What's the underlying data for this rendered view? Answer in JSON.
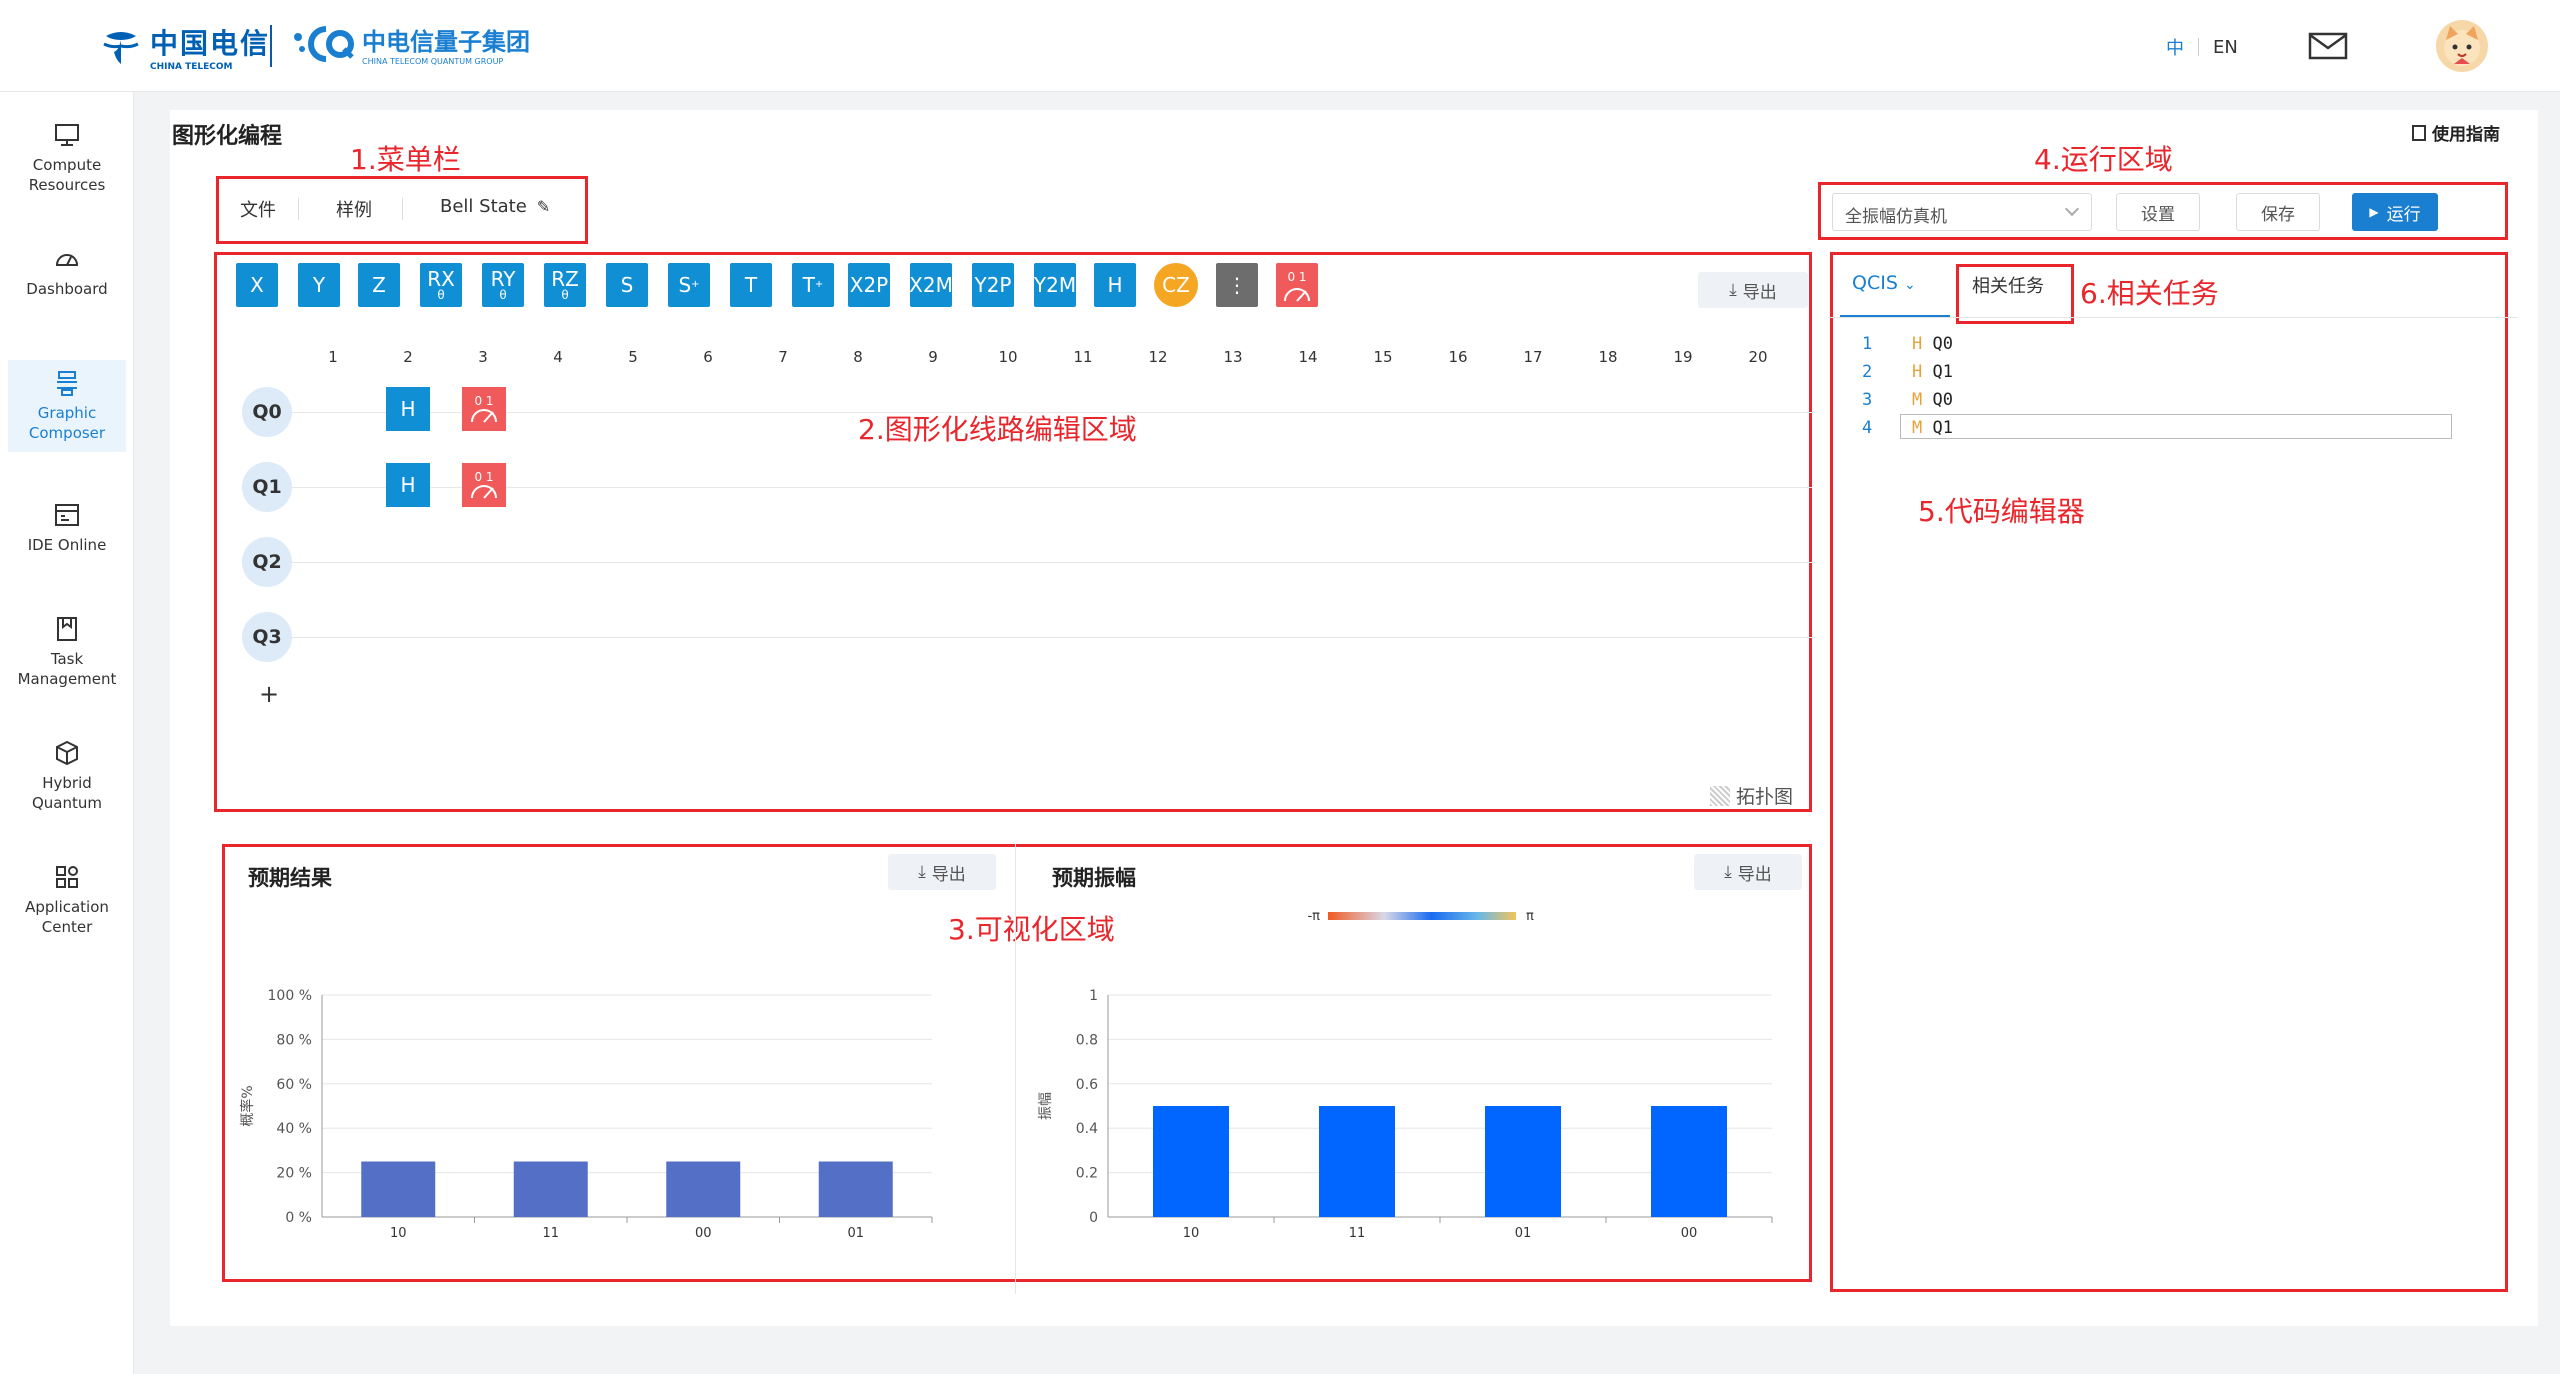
{
  "header": {
    "logo_ct_cn": "中国电信",
    "logo_ct_en": "CHINA TELECOM",
    "logo_q_cn": "中电信量子集团",
    "logo_q_en": "CHINA TELECOM QUANTUM GROUP",
    "lang_zh": "中",
    "lang_en": "EN"
  },
  "sidebar": {
    "items": [
      {
        "label": "Compute Resources",
        "icon": "monitor-icon"
      },
      {
        "label": "Dashboard",
        "icon": "dashboard-icon"
      },
      {
        "label": "Graphic Composer",
        "icon": "composer-icon",
        "active": true
      },
      {
        "label": "IDE Online",
        "icon": "ide-icon"
      },
      {
        "label": "Task Management",
        "icon": "task-icon"
      },
      {
        "label": "Hybrid Quantum",
        "icon": "cube-icon"
      },
      {
        "label": "Application Center",
        "icon": "apps-icon"
      }
    ]
  },
  "page": {
    "title": "图形化编程",
    "guide": "使用指南"
  },
  "annotations": {
    "menu": "1.菜单栏",
    "circuit": "2.图形化线路编辑区域",
    "visual": "3.可视化区域",
    "run": "4.运行区域",
    "editor": "5.代码编辑器",
    "tasks": "6.相关任务"
  },
  "menu": {
    "file": "文件",
    "examples": "样例",
    "circuit_name": "Bell State"
  },
  "gates": [
    {
      "label": "X"
    },
    {
      "label": "Y"
    },
    {
      "label": "Z"
    },
    {
      "label": "RX",
      "sub": "θ"
    },
    {
      "label": "RY",
      "sub": "θ"
    },
    {
      "label": "RZ",
      "sub": "θ"
    },
    {
      "label": "S"
    },
    {
      "label": "S",
      "sup": "+"
    },
    {
      "label": "T"
    },
    {
      "label": "T",
      "sup": "+"
    },
    {
      "label": "X2P"
    },
    {
      "label": "X2M"
    },
    {
      "label": "Y2P"
    },
    {
      "label": "Y2M"
    },
    {
      "label": "H"
    },
    {
      "label": "CZ"
    },
    {
      "label": "⋮"
    },
    {
      "label": "0 1"
    }
  ],
  "export_label": "导出",
  "columns": [
    "1",
    "2",
    "3",
    "4",
    "5",
    "6",
    "7",
    "8",
    "9",
    "10",
    "11",
    "12",
    "13",
    "14",
    "15",
    "16",
    "17",
    "18",
    "19",
    "20"
  ],
  "qubits": [
    "Q0",
    "Q1",
    "Q2",
    "Q3"
  ],
  "add_qubit": "+",
  "placed_gates": [
    {
      "label": "H"
    },
    {
      "label": "H"
    }
  ],
  "meas_label": "0 1",
  "topology": "拓扑图",
  "run": {
    "simulator": "全振幅仿真机",
    "settings": "设置",
    "save": "保存",
    "run": "运行"
  },
  "tabs": {
    "qcis": "QCIS",
    "related": "相关任务"
  },
  "code": [
    {
      "n": "1",
      "op": "H",
      "arg": "Q0"
    },
    {
      "n": "2",
      "op": "H",
      "arg": "Q1"
    },
    {
      "n": "3",
      "op": "M",
      "arg": "Q0"
    },
    {
      "n": "4",
      "op": "M",
      "arg": "Q1"
    }
  ],
  "chart_data": [
    {
      "type": "bar",
      "title": "预期结果",
      "ylabel": "概率%",
      "categories": [
        "10",
        "11",
        "00",
        "01"
      ],
      "values": [
        25,
        25,
        25,
        25
      ],
      "yticks": [
        "0 %",
        "20 %",
        "40 %",
        "60 %",
        "80 %",
        "100 %"
      ],
      "ylim": [
        0,
        100
      ],
      "color": "#5470c6"
    },
    {
      "type": "bar",
      "title": "预期振幅",
      "ylabel": "振幅",
      "categories": [
        "10",
        "11",
        "01",
        "00"
      ],
      "values": [
        0.5,
        0.5,
        0.5,
        0.5
      ],
      "yticks": [
        "0",
        "0.2",
        "0.4",
        "0.6",
        "0.8",
        "1"
      ],
      "ylim": [
        0,
        1
      ],
      "color": "#0066ff",
      "colorbar": {
        "min_label": "-π",
        "max_label": "π"
      }
    }
  ]
}
